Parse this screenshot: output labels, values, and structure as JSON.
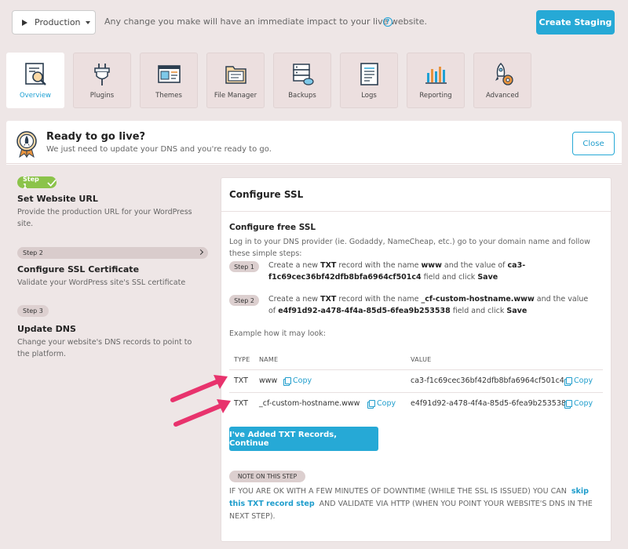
{
  "topbar": {
    "environment": "Production",
    "warning": "Any change you make will have an immediate impact to your live website.",
    "create_staging": "Create Staging"
  },
  "tabs": [
    {
      "label": "Overview",
      "icon": "overview-icon",
      "active": true
    },
    {
      "label": "Plugins",
      "icon": "plugins-icon"
    },
    {
      "label": "Themes",
      "icon": "themes-icon"
    },
    {
      "label": "File Manager",
      "icon": "file-manager-icon"
    },
    {
      "label": "Backups",
      "icon": "backups-icon"
    },
    {
      "label": "Logs",
      "icon": "logs-icon"
    },
    {
      "label": "Reporting",
      "icon": "reporting-icon"
    },
    {
      "label": "Advanced",
      "icon": "advanced-icon"
    }
  ],
  "golive": {
    "title": "Ready to go live?",
    "subtitle": "We just need to update your DNS and you're ready to go.",
    "close": "Close"
  },
  "steps": [
    {
      "pill": "Step 1",
      "title": "Set Website URL",
      "desc": "Provide the production URL for your WordPress site.",
      "status": "done"
    },
    {
      "pill": "Step 2",
      "title": "Configure SSL Certificate",
      "desc": "Validate your WordPress site's SSL certificate",
      "status": "current"
    },
    {
      "pill": "Step 3",
      "title": "Update DNS",
      "desc": "Change your website's DNS records to point to the platform.",
      "status": "todo"
    }
  ],
  "ssl": {
    "title": "Configure SSL",
    "subtitle": "Configure free SSL",
    "intro": "Log in to your DNS provider (ie. Godaddy, NameCheap, etc.) go to your domain name and follow these simple steps:",
    "instructions": [
      {
        "pill": "Step 1",
        "t1": "Create a new ",
        "b1": "TXT",
        "t2": " record with the name ",
        "b2": "www",
        "t3": " and the value of ",
        "b3": "ca3-f1c69cec36bf42dfb8bfa6964cf501c4",
        "t4": " field and click ",
        "b4": "Save"
      },
      {
        "pill": "Step 2",
        "t1": "Create a new ",
        "b1": "TXT",
        "t2": " record with the name ",
        "b2": "_cf-custom-hostname.www",
        "t3": " and the value of ",
        "b3": "e4f91d92-a478-4f4a-85d5-6fea9b253538",
        "t4": " field and click ",
        "b4": "Save"
      }
    ],
    "example": "Example how it may look:",
    "table": {
      "headers": [
        "TYPE",
        "NAME",
        "VALUE"
      ],
      "copy_label": "Copy",
      "rows": [
        {
          "type": "TXT",
          "name": "www",
          "value": "ca3-f1c69cec36bf42dfb8bfa6964cf501c4"
        },
        {
          "type": "TXT",
          "name": "_cf-custom-hostname.www",
          "value": "e4f91d92-a478-4f4a-85d5-6fea9b253538"
        }
      ]
    },
    "continue_button": "I've Added TXT Records, Continue",
    "note": {
      "pill": "NOTE ON THIS STEP",
      "before": "IF YOU ARE OK WITH A FEW MINUTES OF DOWNTIME (WHILE THE SSL IS ISSUED) YOU CAN",
      "link": "skip this TXT record step",
      "after": "AND VALIDATE VIA HTTP (WHEN YOU POINT YOUR WEBSITE'S DNS IN THE NEXT STEP)."
    }
  },
  "colors": {
    "accent": "#26a9d6",
    "success": "#8bc34a",
    "arrow": "#e8336d"
  }
}
